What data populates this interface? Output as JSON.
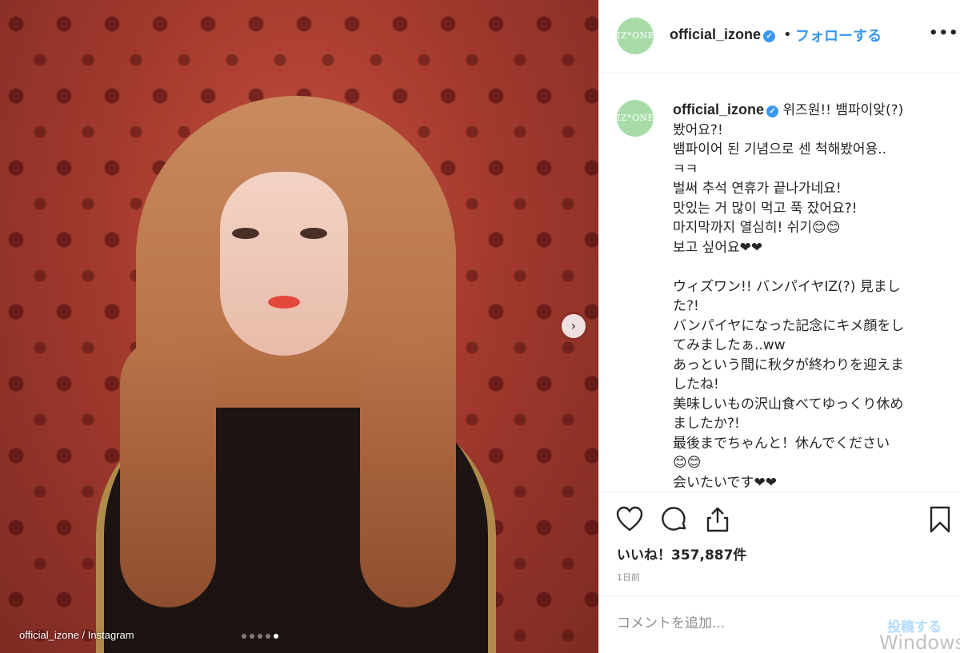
{
  "photo": {
    "credit": "official_izone / Instagram",
    "carousel_total": 5,
    "carousel_active": 5
  },
  "header": {
    "avatar_text": "IZ*ONE",
    "username": "official_izone",
    "verified_glyph": "✓",
    "separator": "•",
    "follow_label": "フォローする",
    "more_label": "•••"
  },
  "caption": {
    "username": "official_izone",
    "lines": [
      "위즈원!! 뱀파이앚(?)",
      "봤어요?!",
      "뱀파이어 된 기념으로 센 척해봤어용..",
      "ㅋㅋ",
      "벌써 추석 연휴가 끝나가네요!",
      "맛있는 거 많이 먹고 푹 잤어요?!",
      "마지막까지 열심히! 쉬기😊😊",
      "보고 싶어요❤❤",
      "",
      "ウィズワン!! バンパイヤIZ(?) 見まし",
      "た?!",
      "バンパイヤになった記念にキメ顔をし",
      "てみましたぁ..ww",
      "あっという間に秋夕が終わりを迎えま",
      "したね!",
      "美味しいもの沢山食べてゆっくり休め",
      "ましたか?!",
      "最後までちゃんと！休んでください",
      "😊😊",
      "会いたいです❤❤"
    ]
  },
  "actions": {
    "like_icon": "heart-icon",
    "comment_icon": "comment-bubble-icon",
    "share_icon": "share-icon",
    "save_icon": "bookmark-icon",
    "likes_text": "いいね！357,887件",
    "time_text": "1日前"
  },
  "comment": {
    "placeholder": "コメントを追加...",
    "post_label": "投稿する",
    "watermark": "Windows"
  },
  "colors": {
    "accent": "#3897f0",
    "post_disabled": "#b3dbff",
    "avatar_bg": "#a7dca9"
  }
}
